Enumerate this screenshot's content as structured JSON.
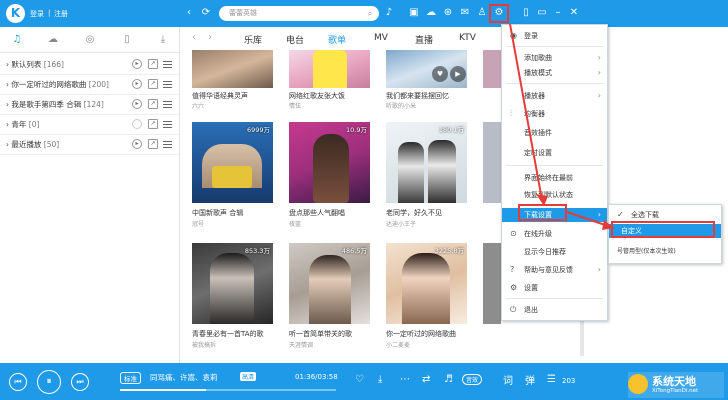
{
  "titlebar": {
    "login": "登录",
    "sep": "|",
    "register": "注册",
    "search_placeholder": "蕾蕾英雄"
  },
  "nav": {
    "tabs": [
      "乐库",
      "电台",
      "歌单",
      "MV",
      "直播",
      "KTV"
    ],
    "active_index": 2
  },
  "sidebar": {
    "playlists": [
      {
        "label": "默认列表",
        "count": "[166]"
      },
      {
        "label": "你一定听过的网络歌曲",
        "count": "[200]"
      },
      {
        "label": "我是歌手第四季 合辑",
        "count": "[124]"
      },
      {
        "label": "青年",
        "count": "[0]"
      },
      {
        "label": "最近播放",
        "count": "[50]"
      }
    ]
  },
  "cards": [
    {
      "title": "值得华语经典灵声",
      "author": "六六",
      "count": ""
    },
    {
      "title": "网络红歌友张大饭",
      "author": "情怯",
      "count": ""
    },
    {
      "title": "我们都来要摇摆回忆",
      "author": "听歌的小米",
      "count": ""
    },
    {
      "title": "中国新歌声 合辑",
      "author": "冠号",
      "count": "6999万"
    },
    {
      "title": "盘点那些人气翻唱",
      "author": "夜蓝",
      "count": "10.9万"
    },
    {
      "title": "老同学，好久不见",
      "author": "达迪小王子",
      "count": "180.1万"
    },
    {
      "title": "青春里必有一首TA的歌",
      "author": "被我搞拆",
      "count": "853.3万"
    },
    {
      "title": "听一首简单带关的歌",
      "author": "天涯情调",
      "count": "486.5万"
    },
    {
      "title": "你一定听过的网络歌曲",
      "author": "小二麦麦",
      "count": "3225.8万"
    }
  ],
  "settings_menu": {
    "items": [
      {
        "label": "登录",
        "icon": "user-icon",
        "arrow": false
      },
      {
        "label": "添加歌曲",
        "icon": "",
        "arrow": true
      },
      {
        "label": "播放模式",
        "icon": "",
        "arrow": true
      },
      {
        "label": "播放器",
        "icon": "",
        "arrow": true
      },
      {
        "label": "均衡器",
        "icon": "eq-icon",
        "arrow": false
      },
      {
        "label": "音效插件",
        "icon": "",
        "arrow": false
      },
      {
        "label": "定时设置",
        "icon": "",
        "arrow": false
      },
      {
        "label": "界面始终在最前",
        "icon": "",
        "arrow": false
      },
      {
        "label": "恢复到默认状态",
        "icon": "",
        "arrow": false
      },
      {
        "label": "下载设置",
        "icon": "",
        "arrow": true
      },
      {
        "label": "在线升级",
        "icon": "upgrade-icon",
        "arrow": false
      },
      {
        "label": "显示今日推荐",
        "icon": "",
        "arrow": false
      },
      {
        "label": "帮助与意见反馈",
        "icon": "help-icon",
        "arrow": true
      },
      {
        "label": "设置",
        "icon": "settings-icon",
        "arrow": false
      },
      {
        "label": "退出",
        "icon": "exit-icon",
        "arrow": false
      }
    ]
  },
  "download_submenu": {
    "items": [
      "全选下载",
      "自定义",
      "号管用型(仅本次生效)"
    ]
  },
  "player": {
    "quality": "标准",
    "song": "同骂痛、许嵩、袁莉",
    "tag": "高清",
    "time": "01:36/03:58",
    "progress": 0.4,
    "volume_label": "203",
    "lyric_label": "词",
    "barrage_label": "弹",
    "speed_label": "音效"
  },
  "watermark": {
    "cn": "系统天地",
    "en": "XiTongTianDi.net"
  },
  "colors": {
    "brand": "#1f9ae8",
    "highlight": "#1f9ae8",
    "annotation": "#e53b3b"
  }
}
